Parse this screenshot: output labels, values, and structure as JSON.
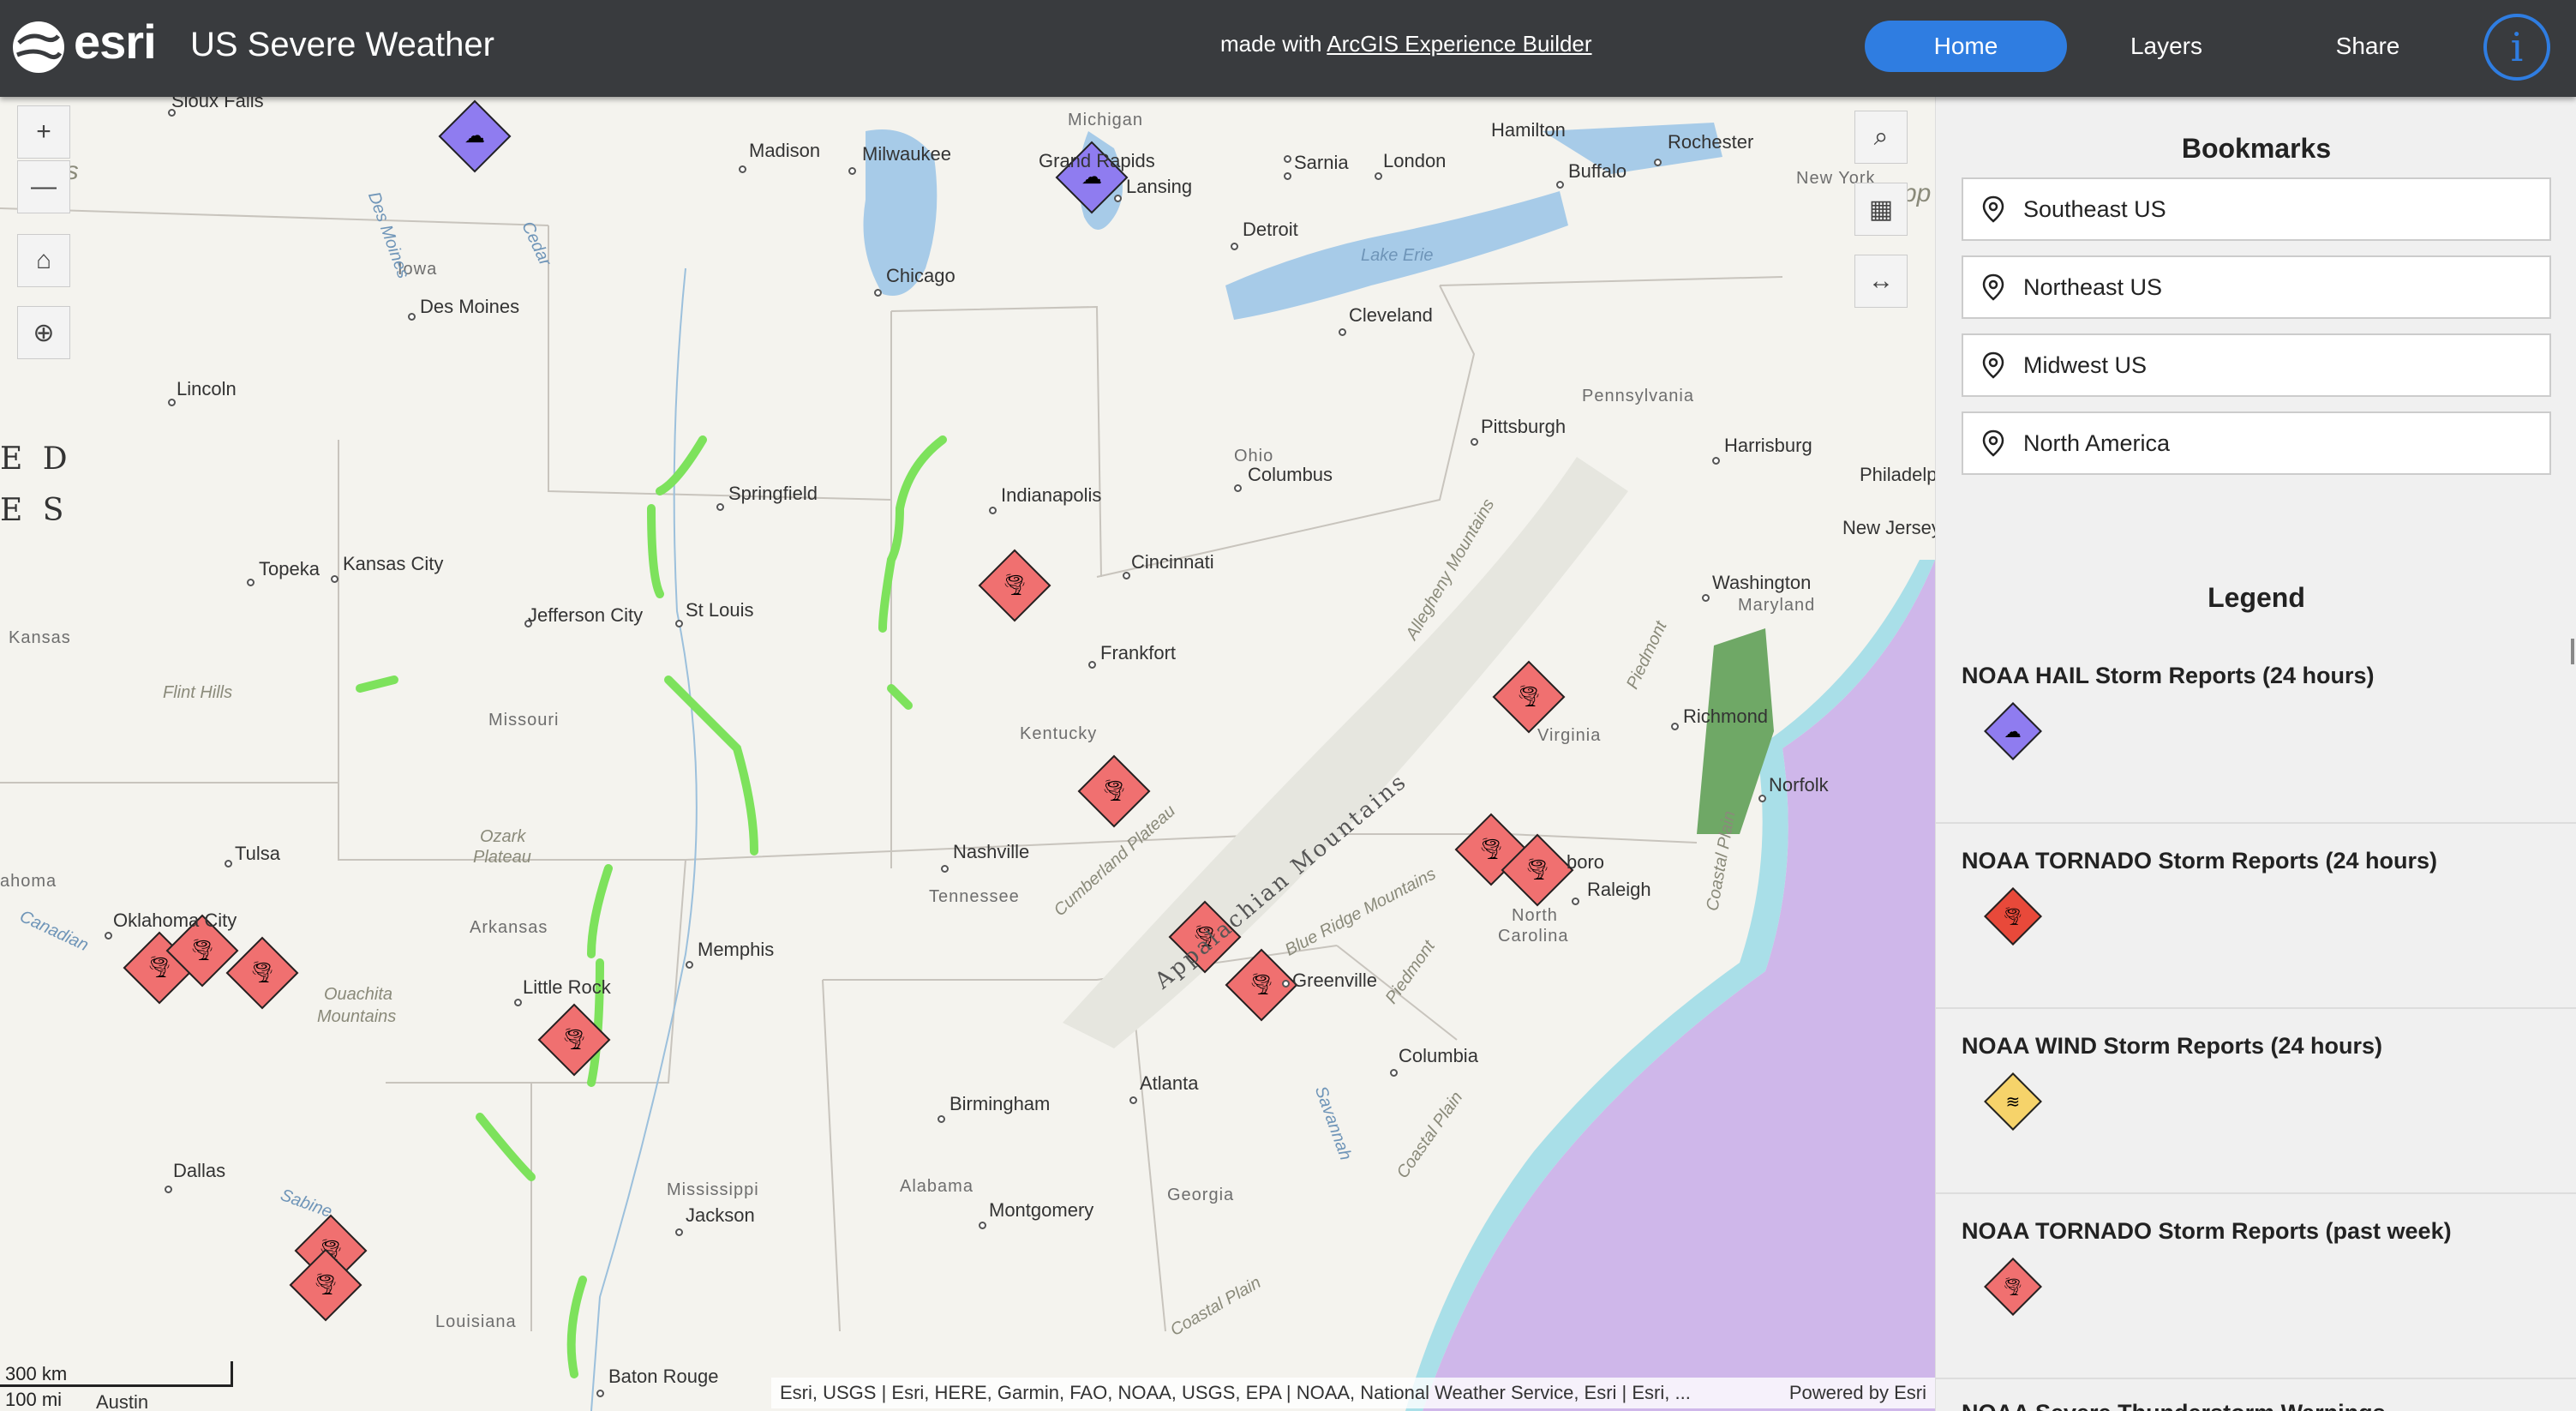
{
  "header": {
    "brand": "esri",
    "title": "US Severe Weather",
    "made_with_prefix": "made with",
    "made_with_link": "ArcGIS Experience Builder",
    "nav": {
      "home": "Home",
      "layers": "Layers",
      "share": "Share"
    },
    "info_glyph": "i"
  },
  "map": {
    "zoom_in": "+",
    "zoom_out": "—",
    "scale_km": "300 km",
    "scale_mi": "100 mi",
    "attribution": "Esri, USGS | Esri, HERE, Garmin, FAO, NOAA, USGS, EPA | NOAA, National Weather Service, Esri | Esri, ...",
    "powered_by": "Powered by Esri",
    "labels": {
      "sioux_falls": "Sioux Falls",
      "madison": "Madison",
      "milwaukee": "Milwaukee",
      "michigan": "Michigan",
      "grand_rapids": "Grand Rapids",
      "lansing": "Lansing",
      "hamilton": "Hamilton",
      "rochester": "Rochester",
      "sarnia": "Sarnia",
      "london": "London",
      "buffalo": "Buffalo",
      "new_york": "New York",
      "iowa": "Iowa",
      "des_moines": "Des Moines",
      "chicago": "Chicago",
      "detroit": "Detroit",
      "lake_erie": "Lake Erie",
      "cleveland": "Cleveland",
      "lincoln": "Lincoln",
      "pennsylvania": "Pennsylvania",
      "pittsburgh": "Pittsburgh",
      "harrisburg": "Harrisburg",
      "philadelphia": "Philadelp",
      "new_jersey": "New Jersey",
      "springfield": "Springfield",
      "indianapolis": "Indianapolis",
      "ohio": "Ohio",
      "columbus": "Columbus",
      "topeka": "Topeka",
      "kansas_city": "Kansas City",
      "cincinnati": "Cincinnati",
      "washington": "Washington",
      "maryland": "Maryland",
      "kansas": "Kansas",
      "jefferson_city": "Jefferson City",
      "st_louis": "St Louis",
      "frankfort": "Frankfort",
      "allegheny": "Allegheny Mountains",
      "flint_hills": "Flint Hills",
      "missouri": "Missouri",
      "richmond": "Richmond",
      "kentucky": "Kentucky",
      "virginia": "Virginia",
      "piedmont_n": "Piedmont",
      "norfolk": "Norfolk",
      "ozark": "Ozark",
      "plateau": "Plateau",
      "tulsa": "Tulsa",
      "nashville": "Nashville",
      "cumberland": "Cumberland Plateau",
      "appalachian": "Appalachian Mountains",
      "blue_ridge": "Blue Ridge Mountains",
      "greensboro": "boro",
      "coastal_plain_n": "Coastal Plain",
      "oklahoma": "ahoma",
      "tennessee": "Tennessee",
      "raleigh": "Raleigh",
      "north": "North",
      "carolina": "Carolina",
      "oklahoma_city": "Oklahoma City",
      "canadian": "Canadian",
      "arkansas": "Arkansas",
      "memphis": "Memphis",
      "little_rock": "Little Rock",
      "ouachita": "Ouachita",
      "mountains": "Mountains",
      "greenville": "Greenville",
      "piedmont_s": "Piedmont",
      "columbia": "Columbia",
      "birmingham": "Birmingham",
      "atlanta": "Atlanta",
      "savannah": "Savannah",
      "coastal_plain_s": "Coastal Plain",
      "dallas": "Dallas",
      "sabine": "Sabine",
      "mississippi": "Mississippi",
      "alabama": "Alabama",
      "jackson": "Jackson",
      "georgia": "Georgia",
      "montgomery": "Montgomery",
      "louisiana": "Louisiana",
      "coastal_plain_ga": "Coastal Plain",
      "baton_rouge": "Baton Rouge",
      "austin": "Austin",
      "des_moines_river": "Des Moines",
      "cedar": "Cedar",
      "united_1": "E D",
      "united_2": "E S",
      "ns": "ns",
      "pp": "pp"
    }
  },
  "panel": {
    "bookmarks_title": "Bookmarks",
    "bookmarks": [
      "Southeast US",
      "Northeast US",
      "Midwest US",
      "North America"
    ],
    "legend_title": "Legend",
    "legend": [
      {
        "title": "NOAA HAIL Storm Reports (24 hours)",
        "color": "#8f7cf0",
        "glyph": "☁"
      },
      {
        "title": "NOAA TORNADO Storm Reports (24 hours)",
        "color": "#e8493a",
        "glyph": "🌪"
      },
      {
        "title": "NOAA WIND Storm Reports (24 hours)",
        "color": "#f6d36a",
        "glyph": "≋"
      },
      {
        "title": "NOAA TORNADO Storm Reports (past week)",
        "color": "#f07070",
        "glyph": "🌪"
      },
      {
        "title": "NOAA Severe Thunderstorm Warnings",
        "color": "#f0a040",
        "glyph": ""
      }
    ]
  },
  "colors": {
    "header": "#393b3e",
    "accent": "#2f7de1",
    "tornado": "#f07070",
    "hail": "#8f7cf0",
    "wind": "#f6d36a"
  }
}
